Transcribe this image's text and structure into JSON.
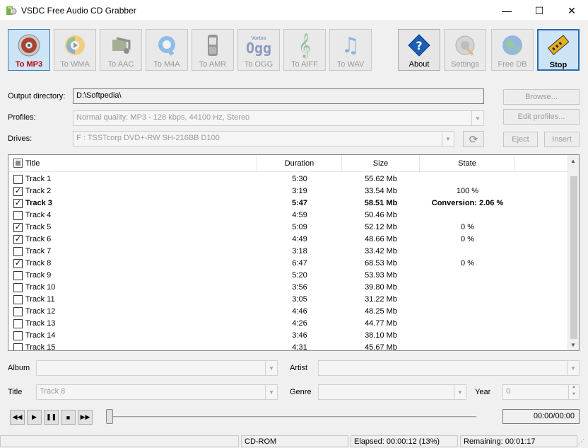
{
  "window": {
    "title": "VSDC Free Audio CD Grabber",
    "minimize": "—",
    "maximize": "☐",
    "close": "✕"
  },
  "toolbar": {
    "formats": [
      {
        "label": "To MP3",
        "icon": "disc-icon",
        "state": "active"
      },
      {
        "label": "To WMA",
        "icon": "wma-icon",
        "state": "disabled"
      },
      {
        "label": "To AAC",
        "icon": "aac-icon",
        "state": "disabled"
      },
      {
        "label": "To M4A",
        "icon": "m4a-icon",
        "state": "disabled"
      },
      {
        "label": "To AMR",
        "icon": "phone-icon",
        "state": "disabled"
      },
      {
        "label": "To OGG",
        "icon": "ogg-icon",
        "state": "disabled"
      },
      {
        "label": "To AIFF",
        "icon": "treble-clef-icon",
        "state": "disabled"
      },
      {
        "label": "To WAV",
        "icon": "music-note-icon",
        "state": "disabled"
      }
    ],
    "ogg_icon_text": "Ogg",
    "ogg_icon_sub": "Vorbis",
    "about": "About",
    "settings": "Settings",
    "free_db": "Free DB",
    "stop": "Stop"
  },
  "form": {
    "output_label": "Output directory:",
    "output_value": "D:\\Softpedia\\",
    "browse": "Browse...",
    "profiles_label": "Profiles:",
    "profiles_value": "Normal quality: MP3 - 128 kbps, 44100 Hz, Stereo",
    "edit_profiles": "Edit profiles...",
    "drives_label": "Drives:",
    "drives_value": "F : TSSTcorp DVD+-RW SH-216BB D100",
    "eject": "Eject",
    "insert": "Insert"
  },
  "list": {
    "columns": [
      "Title",
      "Duration",
      "Size",
      "State"
    ],
    "rows": [
      {
        "title": "Track 1",
        "duration": "5:30",
        "size": "55.62 Mb",
        "state": "",
        "checked": false
      },
      {
        "title": "Track 2",
        "duration": "3:19",
        "size": "33.54 Mb",
        "state": "100 %",
        "checked": true
      },
      {
        "title": "Track 3",
        "duration": "5:47",
        "size": "58.51 Mb",
        "state": "Conversion: 2.06 %",
        "checked": true,
        "bold": true
      },
      {
        "title": "Track 4",
        "duration": "4:59",
        "size": "50.46 Mb",
        "state": "",
        "checked": false
      },
      {
        "title": "Track 5",
        "duration": "5:09",
        "size": "52.12 Mb",
        "state": "0 %",
        "checked": true
      },
      {
        "title": "Track 6",
        "duration": "4:49",
        "size": "48.66 Mb",
        "state": "0 %",
        "checked": true
      },
      {
        "title": "Track 7",
        "duration": "3:18",
        "size": "33.42 Mb",
        "state": "",
        "checked": false
      },
      {
        "title": "Track 8",
        "duration": "6:47",
        "size": "68.53 Mb",
        "state": "0 %",
        "checked": true
      },
      {
        "title": "Track 9",
        "duration": "5:20",
        "size": "53.93 Mb",
        "state": "",
        "checked": false
      },
      {
        "title": "Track 10",
        "duration": "3:56",
        "size": "39.80 Mb",
        "state": "",
        "checked": false
      },
      {
        "title": "Track 11",
        "duration": "3:05",
        "size": "31.22 Mb",
        "state": "",
        "checked": false
      },
      {
        "title": "Track 12",
        "duration": "4:46",
        "size": "48.25 Mb",
        "state": "",
        "checked": false
      },
      {
        "title": "Track 13",
        "duration": "4:26",
        "size": "44.77 Mb",
        "state": "",
        "checked": false
      },
      {
        "title": "Track 14",
        "duration": "3:46",
        "size": "38.10 Mb",
        "state": "",
        "checked": false
      },
      {
        "title": "Track 15",
        "duration": "4:31",
        "size": "45.67 Mb",
        "state": "",
        "checked": false
      }
    ]
  },
  "meta": {
    "album_label": "Album",
    "album_value": "",
    "artist_label": "Artist",
    "artist_value": "",
    "title_label": "Title",
    "title_value": "Track 8",
    "genre_label": "Genre",
    "genre_value": "",
    "year_label": "Year",
    "year_value": "0"
  },
  "player": {
    "time": "00:00/00:00",
    "position": 0
  },
  "status": {
    "source": "CD-ROM",
    "elapsed": "Elapsed: 00:00:12 (13%)",
    "remaining": "Remaining: 00:01:17"
  }
}
